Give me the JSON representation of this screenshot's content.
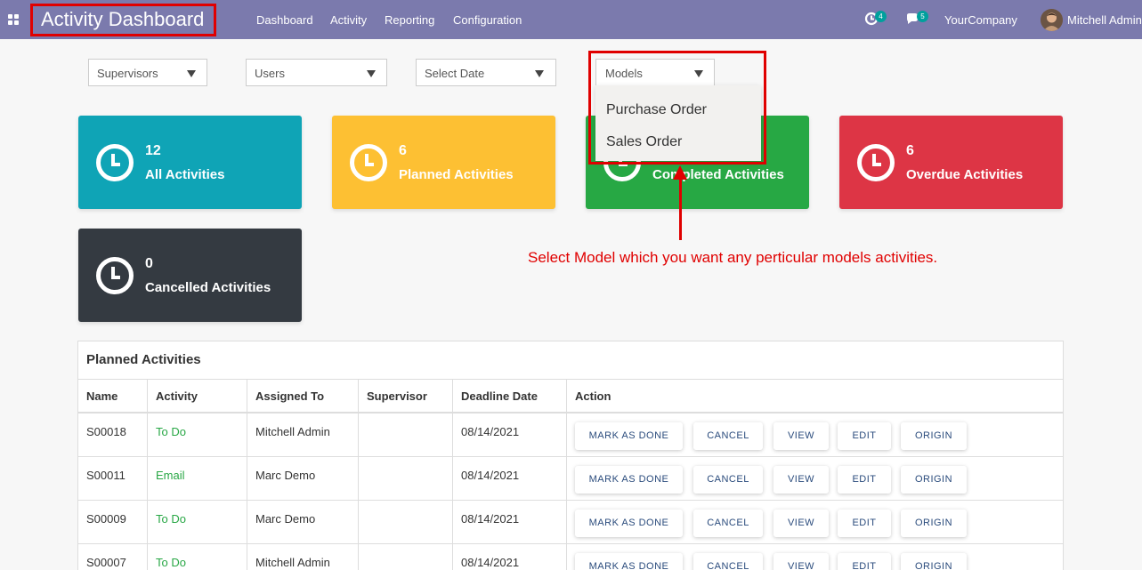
{
  "navbar": {
    "app_title": "Activity Dashboard",
    "menu": [
      "Dashboard",
      "Activity",
      "Reporting",
      "Configuration"
    ],
    "activity_badge": "4",
    "messages_badge": "5",
    "company": "YourCompany",
    "user": "Mitchell Admin"
  },
  "filters": {
    "supervisors": "Supervisors",
    "users": "Users",
    "select_date": "Select Date",
    "models": "Models",
    "models_options": [
      "Purchase Order",
      "Sales Order"
    ]
  },
  "cards": [
    {
      "count": "12",
      "label": "All Activities",
      "color": "#0fa4b6"
    },
    {
      "count": "6",
      "label": "Planned Activities",
      "color": "#fdc033"
    },
    {
      "count": "",
      "label": "Completed Activities",
      "color": "#27a844"
    },
    {
      "count": "6",
      "label": "Overdue Activities",
      "color": "#dd3545"
    },
    {
      "count": "0",
      "label": "Cancelled Activities",
      "color": "#343a41"
    }
  ],
  "annotation": "Select Model which you want any perticular models activities.",
  "table": {
    "title": "Planned Activities",
    "headers": [
      "Name",
      "Activity",
      "Assigned To",
      "Supervisor",
      "Deadline Date",
      "Action"
    ],
    "rows": [
      {
        "name": "S00018",
        "activity": "To Do",
        "assigned": "Mitchell Admin",
        "supervisor": "",
        "deadline": "08/14/2021"
      },
      {
        "name": "S00011",
        "activity": "Email",
        "assigned": "Marc Demo",
        "supervisor": "",
        "deadline": "08/14/2021"
      },
      {
        "name": "S00009",
        "activity": "To Do",
        "assigned": "Marc Demo",
        "supervisor": "",
        "deadline": "08/14/2021"
      },
      {
        "name": "S00007",
        "activity": "To Do",
        "assigned": "Mitchell Admin",
        "supervisor": "",
        "deadline": "08/14/2021"
      }
    ],
    "actions": [
      "MARK AS DONE",
      "CANCEL",
      "VIEW",
      "EDIT",
      "ORIGIN"
    ]
  }
}
